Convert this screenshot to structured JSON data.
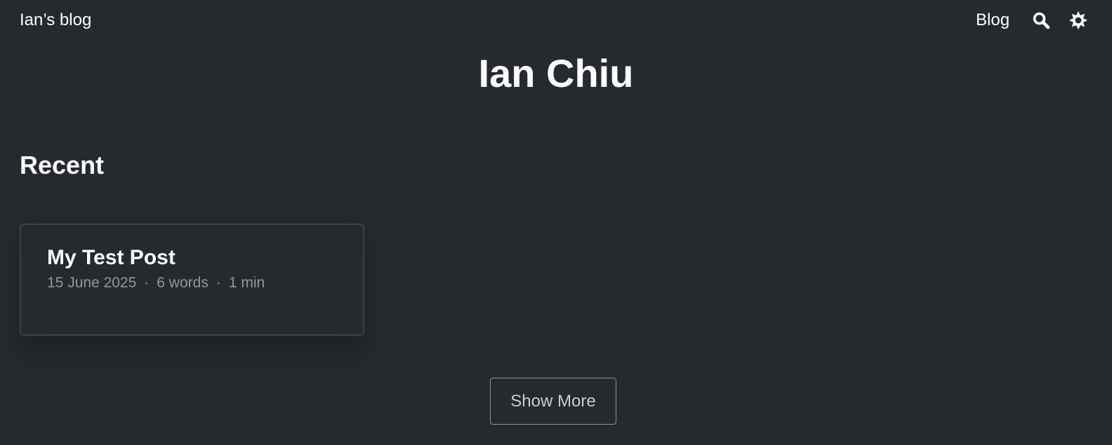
{
  "header": {
    "brand": "Ian’s blog",
    "nav_blog": "Blog",
    "search_icon": "search-icon",
    "theme_icon": "sun-icon"
  },
  "hero": {
    "title": "Ian Chiu"
  },
  "recent": {
    "heading": "Recent",
    "posts": [
      {
        "title": "My Test Post",
        "date": "15 June 2025",
        "words": "6 words",
        "reading_time": "1 min",
        "separator": "·"
      }
    ]
  },
  "show_more_label": "Show More",
  "colors": {
    "background": "#262a2f",
    "text": "#ffffff",
    "meta": "#8f98a1",
    "card_border": "#3c4148",
    "button_border": "#8c9399"
  }
}
